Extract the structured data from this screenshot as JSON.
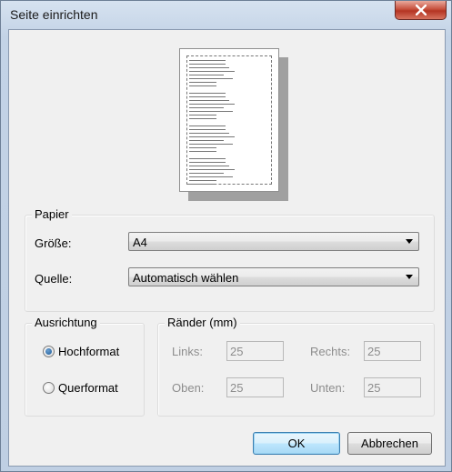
{
  "window": {
    "title": "Seite einrichten",
    "close_icon": "close-icon"
  },
  "colors": {
    "accent": "#3c7fb1",
    "close": "#c7503d"
  },
  "paper": {
    "legend": "Papier",
    "size_label": "Größe:",
    "size_value": "A4",
    "source_label": "Quelle:",
    "source_value": "Automatisch wählen"
  },
  "orientation": {
    "legend": "Ausrichtung",
    "portrait_label": "Hochformat",
    "landscape_label": "Querformat",
    "selected": "portrait"
  },
  "margins": {
    "legend": "Ränder (mm)",
    "left_label": "Links:",
    "left_value": "25",
    "right_label": "Rechts:",
    "right_value": "25",
    "top_label": "Oben:",
    "top_value": "25",
    "bottom_label": "Unten:",
    "bottom_value": "25"
  },
  "buttons": {
    "ok": "OK",
    "cancel": "Abbrechen"
  }
}
